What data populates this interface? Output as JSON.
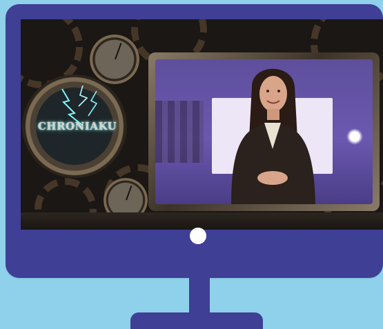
{
  "scene": {
    "monitor_color": "#3e3f95",
    "background_color": "#8fd0ea",
    "camera_dot_color": "#ffffff"
  },
  "screen": {
    "logo_text": "CHRONIAKU",
    "theme": "steampunk-clockwork",
    "accent_glow_color": "#5ff3ff",
    "video_background_color": "#6b58b0"
  },
  "icons": [
    "camera-dot-icon",
    "clock-icon",
    "gear-icon",
    "lightning-icon"
  ]
}
